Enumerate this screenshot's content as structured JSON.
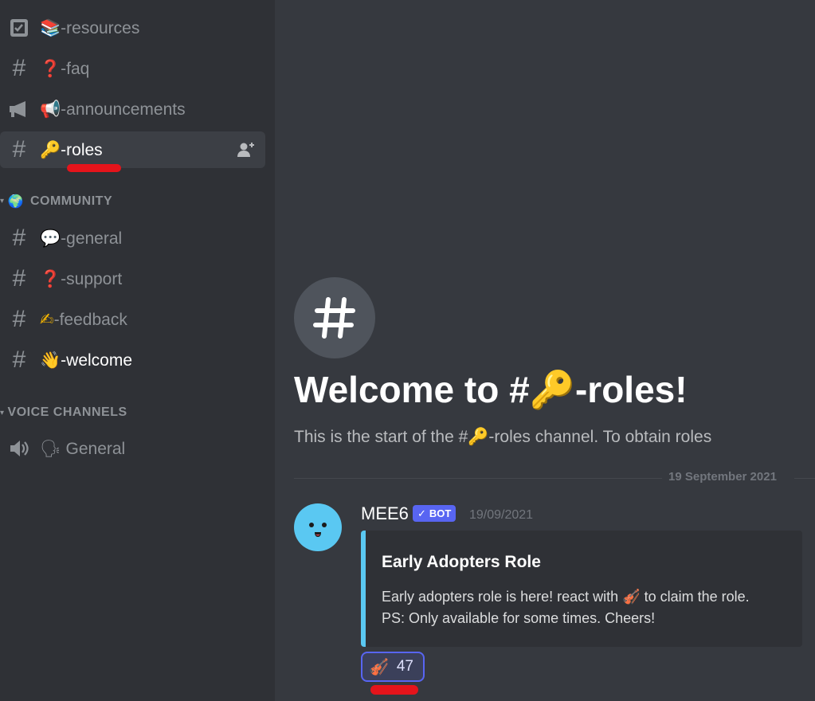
{
  "sidebar": {
    "channels_top": [
      {
        "emoji": "📚",
        "label": "-resources",
        "icon": "rules-checkbox-icon"
      },
      {
        "emoji": "❓",
        "label": "-faq",
        "icon": "hash-icon"
      },
      {
        "emoji": "📢",
        "label": "-announcements",
        "icon": "megaphone-icon"
      },
      {
        "emoji": "🔑",
        "label": "-roles",
        "icon": "hash-icon",
        "active": true
      }
    ],
    "community_category": {
      "emoji": "🌍",
      "label": "COMMUNITY"
    },
    "community_channels": [
      {
        "emoji": "💬",
        "label": "-general"
      },
      {
        "emoji": "❓",
        "label": "-support"
      },
      {
        "emoji": "✍",
        "label": "-feedback"
      },
      {
        "emoji": "👋",
        "label": "-welcome"
      }
    ],
    "voice_category": {
      "label": "VOICE CHANNELS"
    },
    "voice_channels": [
      {
        "emoji": "🗣",
        "label": "General"
      }
    ]
  },
  "main": {
    "welcome_prefix": "Welcome to #",
    "welcome_emoji": "🔑",
    "welcome_suffix": "-roles!",
    "sub_prefix": "This is the start of the #",
    "sub_emoji": "🔑",
    "sub_suffix": "-roles channel. To obtain roles",
    "date_divider": "19 September 2021",
    "message": {
      "author": "MEE6",
      "bot_tag": "BOT",
      "timestamp": "19/09/2021",
      "embed_title": "Early Adopters Role",
      "embed_line1_prefix": "Early adopters role is here! react with ",
      "embed_emoji": "🎻",
      "embed_line1_suffix": " to claim the role.",
      "embed_line2": "PS: Only available for some times. Cheers!",
      "reaction_emoji": "🎻",
      "reaction_count": "47"
    }
  },
  "colors": {
    "sidebar_bg": "#2f3136",
    "main_bg": "#36393f",
    "accent": "#5865f2",
    "embed_border": "#5ac8f2",
    "annotation_red": "#e5141b"
  }
}
